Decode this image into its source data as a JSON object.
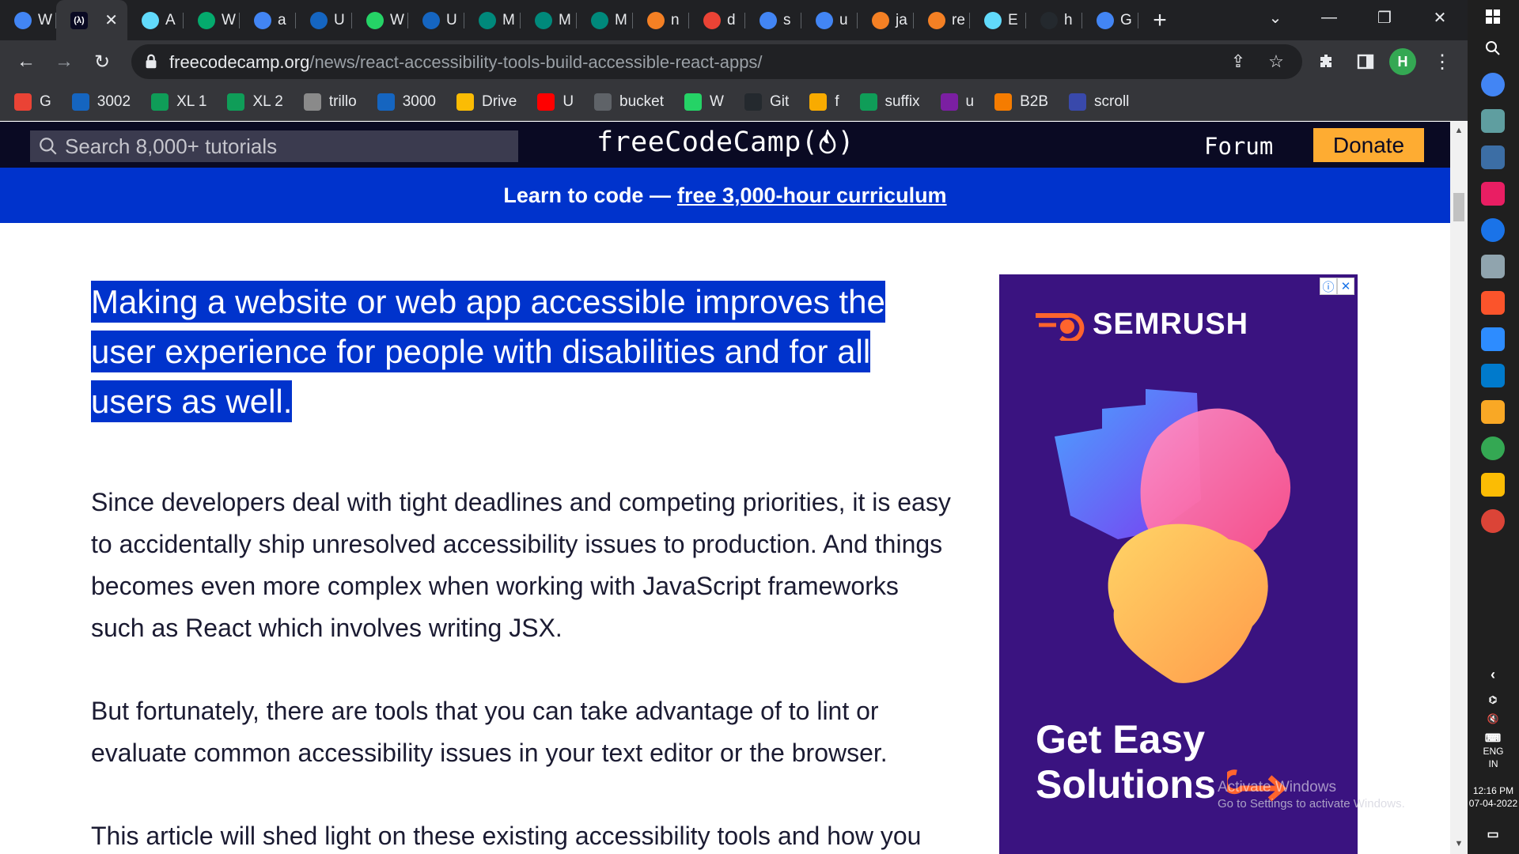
{
  "tabs": [
    {
      "label": "W",
      "icon": "google-icon",
      "color": "#4285f4"
    },
    {
      "label": "",
      "icon": "freecodecamp-icon",
      "color": "#0a0a23",
      "active": true
    },
    {
      "label": "A",
      "icon": "react-icon",
      "color": "#61dafb"
    },
    {
      "label": "W",
      "icon": "w3schools-icon",
      "color": "#04aa6d"
    },
    {
      "label": "a",
      "icon": "google-icon",
      "color": "#4285f4"
    },
    {
      "label": "U",
      "icon": "ac-logo-icon",
      "color": "#1565c0"
    },
    {
      "label": "W",
      "icon": "whatsapp-icon",
      "color": "#25d366"
    },
    {
      "label": "U",
      "icon": "ac-logo-icon",
      "color": "#1565c0"
    },
    {
      "label": "M",
      "icon": "meet-icon",
      "color": "#00897b"
    },
    {
      "label": "M",
      "icon": "meet-icon",
      "color": "#00897b"
    },
    {
      "label": "M",
      "icon": "meet-icon",
      "color": "#00897b"
    },
    {
      "label": "n",
      "icon": "stackoverflow-icon",
      "color": "#f48024"
    },
    {
      "label": "d",
      "icon": "gmail-icon",
      "color": "#ea4335"
    },
    {
      "label": "s",
      "icon": "google-icon",
      "color": "#4285f4"
    },
    {
      "label": "u",
      "icon": "google-icon",
      "color": "#4285f4"
    },
    {
      "label": "ja",
      "icon": "stackoverflow-icon",
      "color": "#f48024"
    },
    {
      "label": "re",
      "icon": "stackoverflow-icon",
      "color": "#f48024"
    },
    {
      "label": "E",
      "icon": "react-icon",
      "color": "#61dafb"
    },
    {
      "label": "h",
      "icon": "github-icon",
      "color": "#24292e"
    },
    {
      "label": "G",
      "icon": "google-icon",
      "color": "#4285f4"
    }
  ],
  "address": {
    "host": "freecodecamp.org",
    "path": "/news/react-accessibility-tools-build-accessible-react-apps/"
  },
  "profile_initial": "H",
  "bookmarks": [
    {
      "label": "G",
      "icon": "gmail-icon",
      "color": "#ea4335"
    },
    {
      "label": "3002",
      "icon": "ac-logo-icon",
      "color": "#1565c0"
    },
    {
      "label": "XL 1",
      "icon": "plus-green-icon",
      "color": "#0f9d58"
    },
    {
      "label": "XL 2",
      "icon": "plus-green-icon",
      "color": "#0f9d58"
    },
    {
      "label": "trillo",
      "icon": "trillo-icon",
      "color": "#8a8a8a"
    },
    {
      "label": "3000",
      "icon": "ac-logo-icon",
      "color": "#1565c0"
    },
    {
      "label": "Drive",
      "icon": "drive-icon",
      "color": "#fbbc04"
    },
    {
      "label": "U",
      "icon": "youtube-icon",
      "color": "#ff0000"
    },
    {
      "label": "bucket",
      "icon": "globe-icon",
      "color": "#5f6368"
    },
    {
      "label": "W",
      "icon": "whatsapp-icon",
      "color": "#25d366"
    },
    {
      "label": "Git",
      "icon": "github-icon",
      "color": "#24292e"
    },
    {
      "label": "f",
      "icon": "sticky-note-icon",
      "color": "#f9ab00"
    },
    {
      "label": "suffix",
      "icon": "plus-green-icon",
      "color": "#0f9d58"
    },
    {
      "label": "u",
      "icon": "ublock-icon",
      "color": "#7b1fa2"
    },
    {
      "label": "B2B",
      "icon": "b2b-icon",
      "color": "#f57c00"
    },
    {
      "label": "scroll",
      "icon": "p-icon",
      "color": "#3949ab"
    }
  ],
  "nav": {
    "search_placeholder": "Search 8,000+ tutorials",
    "logo_text": "freeCodeCamp(",
    "logo_end": ")",
    "forum": "Forum",
    "donate": "Donate"
  },
  "banner": {
    "prefix": "Learn to code —",
    "link": "free 3,000-hour curriculum"
  },
  "article": {
    "lead": "Making a website or web app accessible improves the user experience for people with disabilities and for all users as well.",
    "paragraphs": [
      "Since developers deal with tight deadlines and competing priorities, it is easy to accidentally ship unresolved accessibility issues to production. And things becomes even more complex when working with JavaScript frameworks such as React which involves writing JSX.",
      "But fortunately, there are tools that you can take advantage of to lint or evaluate common accessibility issues in your text editor or the browser.",
      "This article will shed light on these existing accessibility tools and how you"
    ]
  },
  "ad": {
    "brand": "SEMRUSH",
    "headline_1": "Get Easy",
    "headline_2": "Solutions"
  },
  "watermark": {
    "title": "Activate Windows",
    "subtitle": "Go to Settings to activate Windows."
  },
  "system": {
    "lang_1": "ENG",
    "lang_2": "IN",
    "time": "12:16 PM",
    "date": "07-04-2022"
  },
  "colors": {
    "fcc_nav": "#0a0a23",
    "banner": "#0033cc",
    "donate": "#feac32",
    "ad_bg": "#3a1380"
  }
}
